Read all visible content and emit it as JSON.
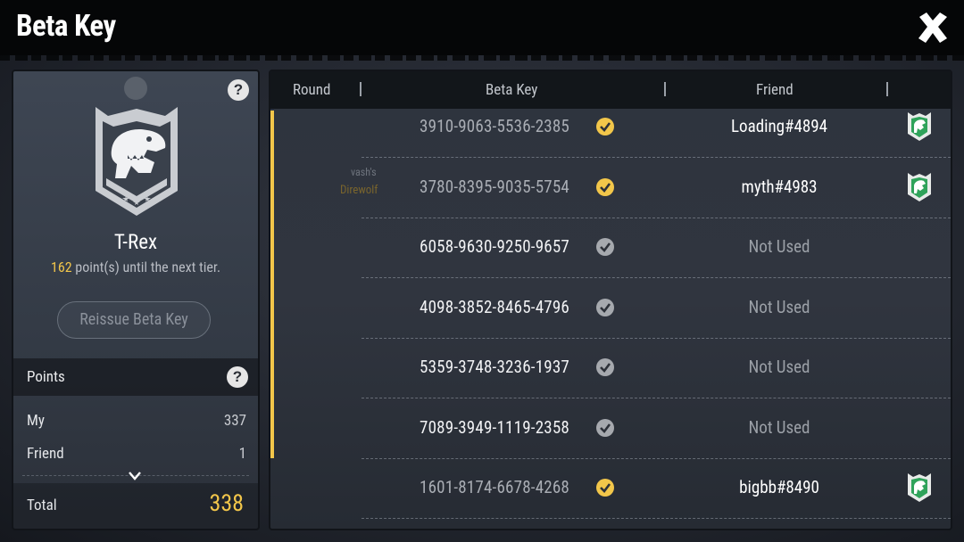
{
  "header": {
    "title": "Beta Key",
    "close_icon": "close-x-icon"
  },
  "tier": {
    "name": "T-Rex",
    "points_needed": "162",
    "points_suffix": " point(s) until the next tier.",
    "badge_icon": "trex-shield-badge-icon"
  },
  "reissue_label": "Reissue Beta Key",
  "points": {
    "header": "Points",
    "rows": [
      {
        "label": "My",
        "value": "337"
      },
      {
        "label": "Friend",
        "value": "1"
      }
    ],
    "total_label": "Total",
    "total_value": "338"
  },
  "table": {
    "columns": {
      "round": "Round",
      "key": "Beta Key",
      "friend": "Friend"
    },
    "background_text": {
      "player": "vash's",
      "tag": "Direwolf"
    },
    "rows": [
      {
        "key": "3910-9063-5536-2385",
        "status": "used",
        "friend": "Loading#4894"
      },
      {
        "key": "3780-8395-9035-5754",
        "status": "used",
        "friend": "myth#4983"
      },
      {
        "key": "6058-9630-9250-9657",
        "status": "unused",
        "friend": "Not Used"
      },
      {
        "key": "4098-3852-8465-4796",
        "status": "unused",
        "friend": "Not Used"
      },
      {
        "key": "5359-3748-3236-1937",
        "status": "unused",
        "friend": "Not Used"
      },
      {
        "key": "7089-3949-1119-2358",
        "status": "unused",
        "friend": "Not Used"
      },
      {
        "key": "1601-8174-6678-4268",
        "status": "used",
        "friend": "bigbb#8490"
      }
    ]
  },
  "colors": {
    "accent_gold": "#f2c64a",
    "check_used": "#f2c64a",
    "check_unused": "#a6a9ae",
    "friend_icon": "#2fa35a"
  }
}
